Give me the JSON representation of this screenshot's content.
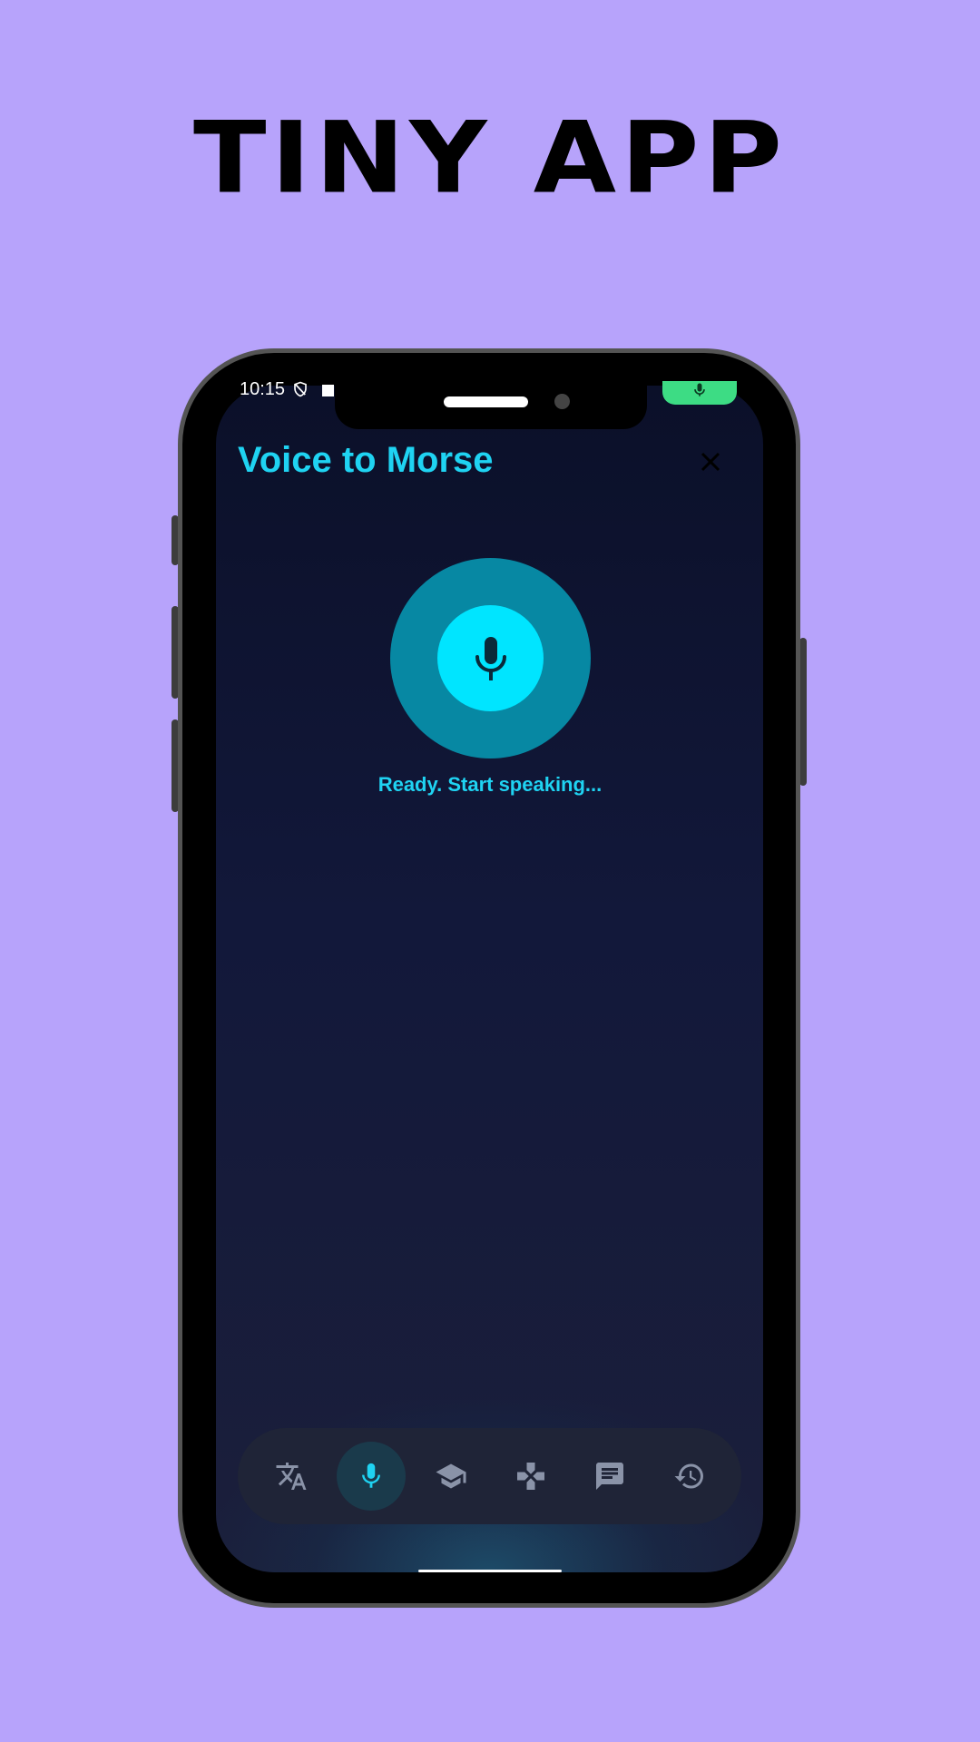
{
  "promo": {
    "title": "TINY APP"
  },
  "status_bar": {
    "time": "10:15"
  },
  "header": {
    "title": "Voice to Morse"
  },
  "main": {
    "status_text": "Ready. Start speaking..."
  },
  "nav": {
    "items": [
      {
        "icon": "translate-icon",
        "active": false
      },
      {
        "icon": "mic-icon",
        "active": true
      },
      {
        "icon": "school-icon",
        "active": false
      },
      {
        "icon": "gamepad-icon",
        "active": false
      },
      {
        "icon": "chat-icon",
        "active": false
      },
      {
        "icon": "history-icon",
        "active": false
      }
    ]
  },
  "colors": {
    "background": "#b7a3fb",
    "accent": "#1fd3f2",
    "mic_outer": "#0788a3",
    "mic_inner": "#00e5ff",
    "nav_inactive": "#8a93a8",
    "mic_indicator": "#3ddc84"
  }
}
